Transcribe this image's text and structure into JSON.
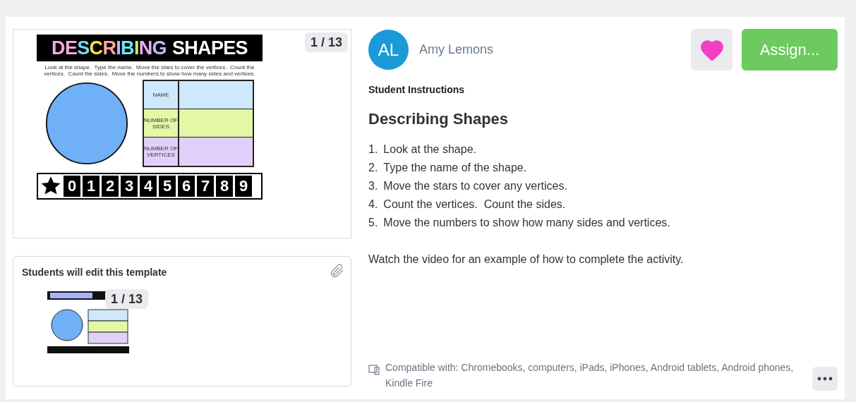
{
  "slide_preview": {
    "title_parts": [
      {
        "text": "DESCRIBING",
        "kind": "rainbow"
      },
      {
        "text": "SHAPES",
        "kind": "plain"
      }
    ],
    "instructions": "Look at the shape.  Type the name.  Move the stars to cover the vertices.  Count the vertices.  Count the sides.  Move the numbers to show how many sides and vertices.",
    "table_rows": [
      {
        "label": "NAME",
        "color": "#cfe8fb"
      },
      {
        "label": "NUMBER OF SIDES",
        "color": "#e3f7a4"
      },
      {
        "label": "NUMBER OF VERTICES",
        "color": "#e2cffb"
      }
    ],
    "number_tiles": [
      "0",
      "1",
      "2",
      "3",
      "4",
      "5",
      "6",
      "7",
      "8",
      "9"
    ],
    "page_badge": "1 / 13"
  },
  "template": {
    "heading": "Students will edit this template",
    "page_badge": "1 / 13"
  },
  "author": {
    "initials": "AL",
    "name": "Amy Lemons"
  },
  "favorite": {
    "on": true
  },
  "assign_button": "Assign...",
  "instructions": {
    "label": "Student Instructions",
    "title": "Describing Shapes",
    "steps": [
      {
        "number": "1.",
        "text": "Look at the shape."
      },
      {
        "number": "2.",
        "text": "Type the name of the shape."
      },
      {
        "number": "3.",
        "text": "Move the stars to cover any vertices."
      },
      {
        "number": "4.",
        "text": "Count the vertices.  Count the sides."
      },
      {
        "number": "5.",
        "text": "Move the numbers to show how many sides and vertices."
      }
    ],
    "note": "Watch the video for an example of how to complete the activity."
  },
  "compatibility": "Compatible with: Chromebooks, computers, iPads, iPhones, Android tablets, Android phones, Kindle Fire"
}
